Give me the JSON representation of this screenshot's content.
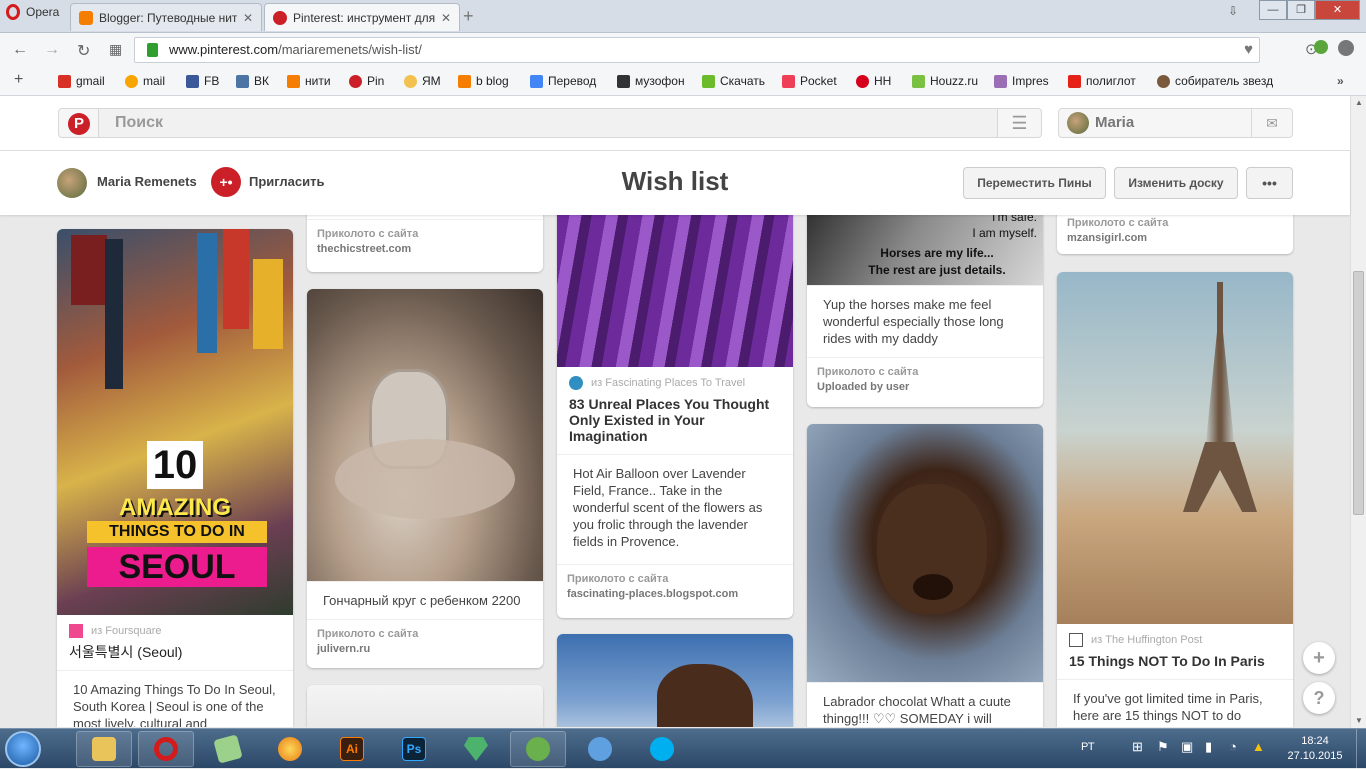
{
  "browser": {
    "menu_label": "Opera",
    "tabs": [
      {
        "title": "Blogger: Путеводные нит",
        "icon": "blogger-icon",
        "color": "#f57d00",
        "active": false
      },
      {
        "title": "Pinterest: инструмент для",
        "icon": "pinterest-icon",
        "color": "#cb2027",
        "active": true
      }
    ],
    "url": {
      "host": "www.pinterest.com",
      "path": "/mariaremenets/wish-list/"
    },
    "bookmarks": [
      {
        "label": "gmail",
        "icon": "gmail-icon",
        "color": "#d93025"
      },
      {
        "label": "mail",
        "icon": "mail-ru-icon",
        "color": "#f7a600"
      },
      {
        "label": "FB",
        "icon": "facebook-icon",
        "color": "#3b5998"
      },
      {
        "label": "ВК",
        "icon": "vk-icon",
        "color": "#4c75a3"
      },
      {
        "label": "нити",
        "icon": "blogger-icon",
        "color": "#f57d00"
      },
      {
        "label": "Pin",
        "icon": "pinterest-icon",
        "color": "#cb2027"
      },
      {
        "label": "ЯМ",
        "icon": "sun-icon",
        "color": "#f2c14e"
      },
      {
        "label": "b blog",
        "icon": "blogger-icon",
        "color": "#f57d00"
      },
      {
        "label": "Перевод",
        "icon": "translate-icon",
        "color": "#4285f4"
      },
      {
        "label": "музофон",
        "icon": "speaker-icon",
        "color": "#333333"
      },
      {
        "label": "Скачать",
        "icon": "download-icon",
        "color": "#6cbb2b"
      },
      {
        "label": "Pocket",
        "icon": "pocket-icon",
        "color": "#ef3f56"
      },
      {
        "label": "НН",
        "icon": "hh-icon",
        "color": "#d6001c"
      },
      {
        "label": "Houzz.ru",
        "icon": "houzz-icon",
        "color": "#7ac142"
      },
      {
        "label": "Impres",
        "icon": "impres-icon",
        "color": "#9b6fb5"
      },
      {
        "label": "полиглот",
        "icon": "youtube-icon",
        "color": "#e62117"
      },
      {
        "label": "собиратель звезд",
        "icon": "gear-icon",
        "color": "#7a5a3a"
      }
    ]
  },
  "pinterest": {
    "search_placeholder": "Поиск",
    "user_name": "Maria",
    "board": {
      "owner": "Maria Remenets",
      "invite_label": "Пригласить",
      "title": "Wish list",
      "move_pins_label": "Переместить Пины",
      "edit_board_label": "Изменить доску",
      "more_label": "•••"
    },
    "pinned_label": "Приколото с сайта",
    "pins": {
      "seoul": {
        "overlay_number": "10",
        "overlay_line1": "AMAZING",
        "overlay_line2": "THINGS TO DO IN",
        "overlay_line3": "SEOUL",
        "source": "из Foursquare",
        "title": "서울특별시 (Seoul)",
        "desc": "10 Amazing Things To Do In Seoul, South Korea | Seoul is one of the most lively, cultural and"
      },
      "chic": {
        "site": "thechicstreet.com"
      },
      "pottery": {
        "desc": "Гончарный круг с ребенком 2200",
        "site": "julivern.ru"
      },
      "lavender": {
        "source": "из Fascinating Places To Travel",
        "title": "83 Unreal Places You Thought Only Existed in Your Imagination",
        "desc": "Hot Air Balloon over Lavender Field, France.. Take in the wonderful scent of the flowers as you frolic through the lavender fields in Provence.",
        "site": "fascinating-places.blogspot.com"
      },
      "horses": {
        "quote_line1": "I'm safe.",
        "quote_line2": "I am myself.",
        "quote_line3": "Horses are my life...",
        "quote_line4": "The rest are just details.",
        "desc": "Yup the horses make me feel wonderful especially those long rides with my daddy",
        "site": "Uploaded by user"
      },
      "labrador": {
        "desc": "Labrador chocolat Whatt a cuute thingg!!! ♡♡ SOMEDAY i will"
      },
      "mzansi": {
        "site": "mzansigirl.com"
      },
      "paris": {
        "source": "из The Huffington Post",
        "title": "15 Things NOT To Do In Paris",
        "desc": "If you've got limited time in Paris, here are 15 things NOT to do"
      }
    }
  },
  "taskbar": {
    "lang": "РТ",
    "time": "18:24",
    "date": "27.10.2015",
    "apps": [
      "explorer-icon",
      "opera-icon",
      "notes-icon",
      "ball-icon",
      "illustrator-icon",
      "photoshop-icon",
      "gem-icon",
      "utorrent-icon",
      "volume-icon",
      "skype-icon"
    ]
  }
}
